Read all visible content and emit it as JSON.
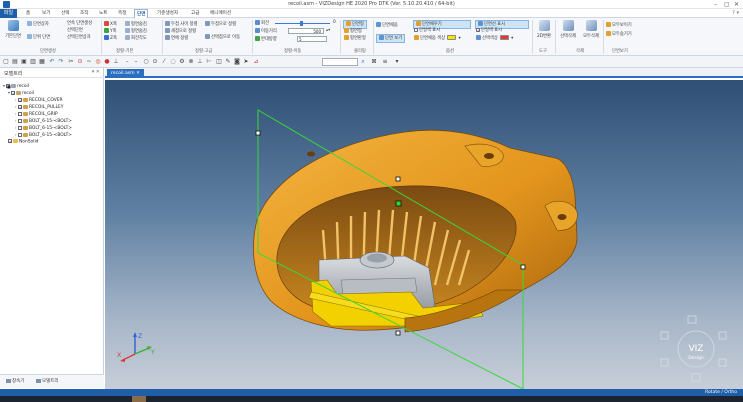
{
  "window": {
    "title": "recoil.asm - VIZDesign HE 2020 Pro DTK (Ver. 5.10.20.410 / 64-bit)",
    "controls": [
      "–",
      "▢",
      "✕"
    ]
  },
  "menu": {
    "file_label": "파일",
    "tabs": [
      "홈",
      "보기",
      "선택",
      "조작",
      "노트",
      "측정",
      "단면",
      "기준생성자",
      "고급",
      "애니메이션"
    ],
    "active_tab": "단면",
    "right_help": "? ▾"
  },
  "ribbon": {
    "g1": {
      "big": "기본단면",
      "r1": "단면상자",
      "r2": "단위 단면",
      "r3": "연속 단면생성",
      "r4": "선택단면",
      "r5": "선택단면상자",
      "label": "단면생성"
    },
    "g2": {
      "a1": "X축",
      "a2": "Y축",
      "a3": "Z축",
      "b1": "평면숨김",
      "b2": "평면숨김",
      "b3": "평면숨김",
      "c1": "회전수정",
      "c2": "회전수정",
      "c3": "회전각도",
      "label": "정렬-기본"
    },
    "g3": {
      "r1": "두점 사이 정렬",
      "r2": "세점으로 정렬",
      "r3": "면에 정렬",
      "s1": "두점으로 정렬",
      "s2": "선택점으로 이동",
      "label": "정렬-고급"
    },
    "g4": {
      "angle_label": "회전",
      "angle_value": "0",
      "move_label": "이동거리",
      "move_value": "500",
      "dir_label": "반대방향",
      "dir_value": "5",
      "label": "정렬-이동"
    },
    "g5": {
      "r1": "단면형",
      "r2": "평면형",
      "r3": "평면판형",
      "label": "클리핑"
    },
    "g6": {
      "r1": "단면채움",
      "r2": "단면 보기",
      "r3": "단면채우기",
      "r4": "단일색 표시",
      "r5": "단면채움 색상",
      "r6": "단면선 표시",
      "r7": "단일색 표시",
      "r8": "선택색상",
      "label": "옵션"
    },
    "g7": {
      "big": "2D변환",
      "label": "도구"
    },
    "g8": {
      "b1": "선택삭제",
      "b2": "모두삭제",
      "label": "삭제"
    },
    "g9": {
      "r1": "모두보이기",
      "r2": "모두숨기기",
      "label": "단면보기"
    }
  },
  "toolbar": {
    "icons": [
      "new-icon",
      "open-icon",
      "save-icon",
      "save-all-icon",
      "undo-icon",
      "redo-icon",
      "print-icon"
    ]
  },
  "tree": {
    "title": "모델트리",
    "close": "▾ ✕",
    "items": [
      {
        "label": "recoil",
        "level": 0
      },
      {
        "label": "recoil",
        "level": 1
      },
      {
        "label": "RECOIL_COVER",
        "level": 2
      },
      {
        "label": "RECOIL_PULLEY",
        "level": 2
      },
      {
        "label": "RECOIL_GRIP",
        "level": 2
      },
      {
        "label": "BOLT_6-15-<BOLT>",
        "level": 2
      },
      {
        "label": "BOLT_6-15-<BOLT>",
        "level": 2
      },
      {
        "label": "BOLT_6-15-<BOLT>",
        "level": 2
      },
      {
        "label": "NonSolid",
        "level": 0
      }
    ],
    "bottom_tabs": [
      "창속기",
      "모델트리"
    ]
  },
  "document": {
    "tab_label": "recoil.asm",
    "tab_close": "✕"
  },
  "viewport": {
    "axis": {
      "x": "X",
      "y": "Y",
      "z": "Z"
    },
    "viewcube_brand": "VIZ",
    "viewcube_sub": "Design",
    "colors": {
      "part": "#e8a020",
      "clip_plane": "#38d838",
      "section": "#f2d200"
    }
  },
  "status": {
    "right_text": "Rotate / Ortho"
  }
}
